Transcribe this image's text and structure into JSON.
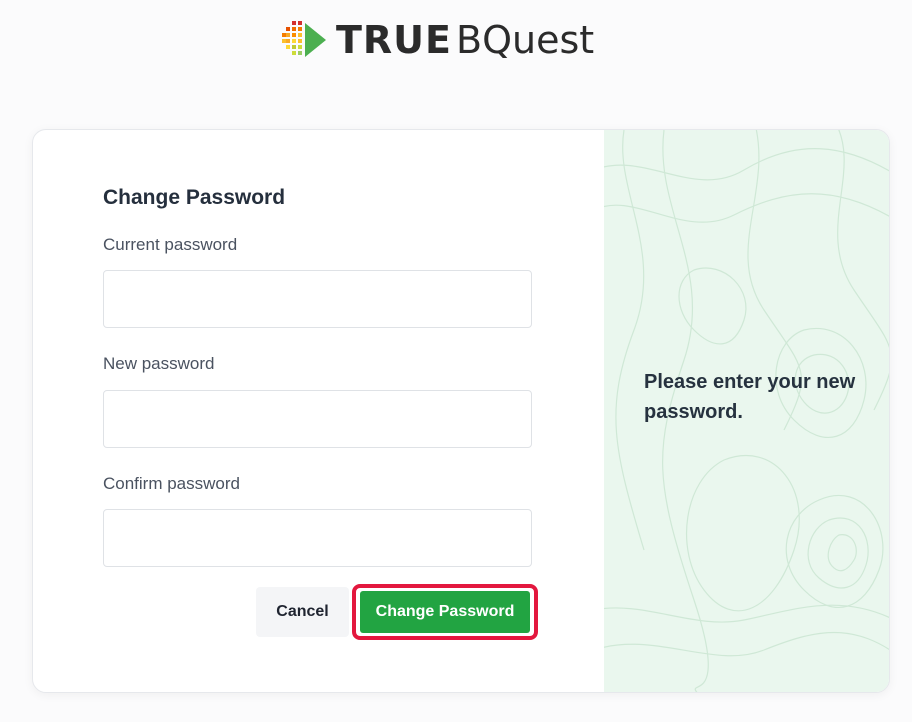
{
  "brand": {
    "name_bold": "TRUE",
    "name_light": "BQuest",
    "logo_icon": "pixel-arrow-logo-icon",
    "colors": {
      "arrow_green": "#4caf50",
      "pixel_red": "#d32f2f",
      "pixel_orange": "#f57c00",
      "pixel_yellow": "#fbc02d"
    }
  },
  "form": {
    "title": "Change Password",
    "fields": [
      {
        "label": "Current password",
        "value": "",
        "placeholder": ""
      },
      {
        "label": "New password",
        "value": "",
        "placeholder": ""
      },
      {
        "label": "Confirm password",
        "value": "",
        "placeholder": ""
      }
    ],
    "cancel_label": "Cancel",
    "submit_label": "Change Password"
  },
  "side_panel": {
    "message": "Please enter your new password.",
    "background_color": "#eaf7ee"
  },
  "colors": {
    "primary_button": "#22a442",
    "highlight_outline": "#e3173e"
  }
}
